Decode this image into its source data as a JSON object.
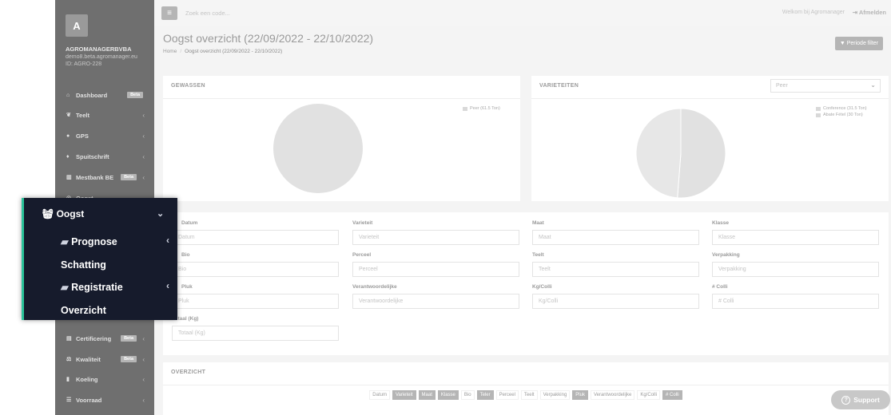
{
  "sidebar": {
    "avatar_letter": "A",
    "company": "AGROMANAGERBVBA",
    "email": "demo8.beta.agromanager.eu",
    "id": "ID: AGRO-228",
    "items": [
      {
        "label": "Dashboard",
        "icon": "home-icon",
        "badge": "Beta"
      },
      {
        "label": "Teelt",
        "icon": "leaf-icon"
      },
      {
        "label": "GPS",
        "icon": "map-marker-icon"
      },
      {
        "label": "Spuitschrift",
        "icon": "drop-icon"
      },
      {
        "label": "Mestbank BE",
        "icon": "bank-icon",
        "badge": "Beta"
      },
      {
        "label": "Oogst",
        "icon": "basket-icon"
      },
      {
        "label": "Certificering",
        "icon": "certificate-icon",
        "badge": "Beta"
      },
      {
        "label": "Kwaliteit",
        "icon": "balance-icon",
        "badge": "Beta"
      },
      {
        "label": "Koeling",
        "icon": "thermometer-icon"
      },
      {
        "label": "Voorraad",
        "icon": "list-icon"
      }
    ]
  },
  "topbar": {
    "search_placeholder": "Zoek een code...",
    "welcome": "Welkom bij Agromanager",
    "logout": "Afmelden"
  },
  "page": {
    "title": "Oogst overzicht (22/09/2022 - 22/10/2022)",
    "crumb_home": "Home",
    "crumb_current": "Oogst overzicht (22/09/2022 - 22/10/2022)",
    "period_button": "Periode filter"
  },
  "gewassen": {
    "title": "GEWASSEN",
    "legend": [
      "Peer (61.5 Ton)"
    ]
  },
  "varieteiten": {
    "title": "VARIETEITEN",
    "selected": "Peer",
    "legend": [
      "Conference (31.5 Ton)",
      "Abate Fétel (30 Ton)"
    ]
  },
  "chart_data": [
    {
      "type": "pie",
      "categories": [
        "Peer"
      ],
      "values": [
        61.5
      ],
      "unit": "Ton"
    },
    {
      "type": "pie",
      "categories": [
        "Conference",
        "Abate Fétel"
      ],
      "values": [
        31.5,
        30
      ],
      "unit": "Ton"
    }
  ],
  "filters": [
    {
      "label": "Datum",
      "placeholder": "Datum"
    },
    {
      "label": "Varieteit",
      "placeholder": "Varieteit"
    },
    {
      "label": "Maat",
      "placeholder": "Maat"
    },
    {
      "label": "Klasse",
      "placeholder": "Klasse"
    },
    {
      "label": "Bio",
      "placeholder": "Bio"
    },
    {
      "label": "Perceel",
      "placeholder": "Perceel"
    },
    {
      "label": "Teelt",
      "placeholder": "Teelt"
    },
    {
      "label": "Verpakking",
      "placeholder": "Verpakking"
    },
    {
      "label": "Pluk",
      "placeholder": "Pluk"
    },
    {
      "label": "Verantwoordelijke",
      "placeholder": "Verantwoordelijke"
    },
    {
      "label": "Kg/Colli",
      "placeholder": "Kg/Colli"
    },
    {
      "label": "# Colli",
      "placeholder": "# Colli"
    },
    {
      "label": "Totaal (Kg)",
      "placeholder": "Totaal (Kg)"
    }
  ],
  "overzicht": {
    "title": "OVERZICHT",
    "columns": [
      {
        "label": "Datum",
        "on": false
      },
      {
        "label": "Varieteit",
        "on": true
      },
      {
        "label": "Maat",
        "on": true
      },
      {
        "label": "Klasse",
        "on": true
      },
      {
        "label": "Bio",
        "on": false
      },
      {
        "label": "Teler",
        "on": true
      },
      {
        "label": "Perceel",
        "on": false
      },
      {
        "label": "Teelt",
        "on": false
      },
      {
        "label": "Verpakking",
        "on": false
      },
      {
        "label": "Pluk",
        "on": true
      },
      {
        "label": "Verantwoordelijke",
        "on": false
      },
      {
        "label": "Kg/Colli",
        "on": false
      },
      {
        "label": "# Colli",
        "on": true
      }
    ]
  },
  "support": "Support",
  "overlay": {
    "oogst": "Oogst",
    "prognose": "Prognose",
    "schatting": "Schatting",
    "registratie": "Registratie",
    "overzicht": "Overzicht"
  },
  "colors": {
    "accent": "#2bc39a",
    "overlay_bg": "#161b2c",
    "sidebar_bg": "#6f6f6f"
  }
}
